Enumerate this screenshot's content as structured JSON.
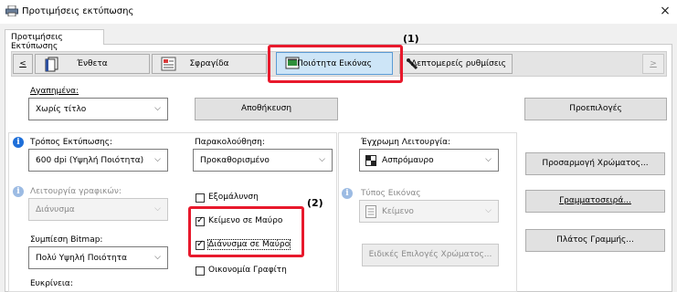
{
  "window": {
    "title": "Προτιμήσεις εκτύπωσης",
    "close_glyph": "×"
  },
  "tabs": [
    {
      "label": "Προτιμήσεις Εκτύπωσης"
    }
  ],
  "toolbar": {
    "scroll_left": "<",
    "scroll_right": ">",
    "tabs": [
      {
        "label": "Ένθετα",
        "icon": "pages-icon"
      },
      {
        "label": "Σφραγίδα",
        "icon": "stamp-icon"
      },
      {
        "label": "Ποιότητα Εικόνας",
        "icon": "image-quality-icon",
        "selected": true
      },
      {
        "label": "Λεπτομερείς ρυθμίσεις",
        "icon": "detail-settings-icon"
      }
    ]
  },
  "favorites": {
    "label": "Αγαπημένα:",
    "value": "Χωρίς τίτλο",
    "save_label": "Αποθήκευση",
    "defaults_label": "Προεπιλογές"
  },
  "print_mode": {
    "label": "Τρόπος Εκτύπωσης:",
    "value": "600 dpi (Υψηλή Ποιότητα)"
  },
  "graphics_mode": {
    "label": "Λειτουργία γραφικών:",
    "value": "Διάνυσμα",
    "disabled": true
  },
  "bitmap_compression": {
    "label": "Συμπίεση Bitmap:",
    "value": "Πολύ Υψηλή Ποιότητα"
  },
  "resolution": {
    "label": "Ευκρίνεια:"
  },
  "monitoring": {
    "label": "Παρακολούθηση:",
    "value": "Προκαθορισμένο"
  },
  "checkboxes": [
    {
      "label": "Εξομάλυνση",
      "checked": false
    },
    {
      "label": "Κείμενο σε Μαύρο",
      "checked": true
    },
    {
      "label": "Διάνυσμα σε Μαύρο",
      "checked": true
    },
    {
      "label": "Οικονομία Γραφίτη",
      "checked": false
    }
  ],
  "color_mode": {
    "label": "Έγχρωμη Λειτουργία:",
    "value": "Ασπρόμαυρο"
  },
  "image_type": {
    "label": "Τύπος Εικόνας",
    "value": "Κείμενο",
    "disabled": true
  },
  "advanced_color": {
    "label": "Ειδικές Επιλογές Χρώματος..."
  },
  "side_buttons": [
    {
      "label": "Προσαρμογή Χρώματος..."
    },
    {
      "label": "Γραμματοσειρά..."
    },
    {
      "label": "Πλάτος Γραμμής..."
    }
  ],
  "callouts": {
    "one": "(1)",
    "two": "(2)"
  },
  "colors": {
    "highlight": "#e8192c",
    "info_blue": "#1e6fd9"
  }
}
